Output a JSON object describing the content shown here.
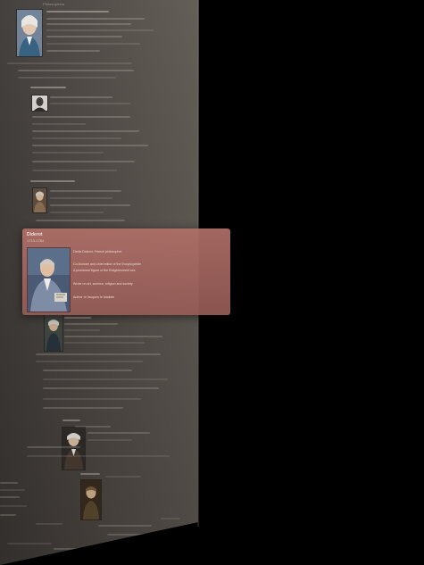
{
  "timeline": {
    "header_label": "Philosophers",
    "entries": [
      {
        "id": "voltaire"
      },
      {
        "id": "rousseau"
      },
      {
        "id": "condillac"
      },
      {
        "id": "montesquieu"
      },
      {
        "id": "kant"
      },
      {
        "id": "hegel"
      }
    ]
  },
  "card": {
    "name": "Diderot",
    "dates": "1713-1784",
    "lines": [
      "Denis Diderot, French philosopher",
      "Co-founder and chief editor of the Encyclopédie",
      "A prominent figure of the Enlightenment era",
      "Wrote on art, science, religion and society",
      "Author of Jacques le fataliste"
    ]
  },
  "colors": {
    "card": "#a86a63",
    "panel": "#4e4843",
    "background": "#000000"
  }
}
